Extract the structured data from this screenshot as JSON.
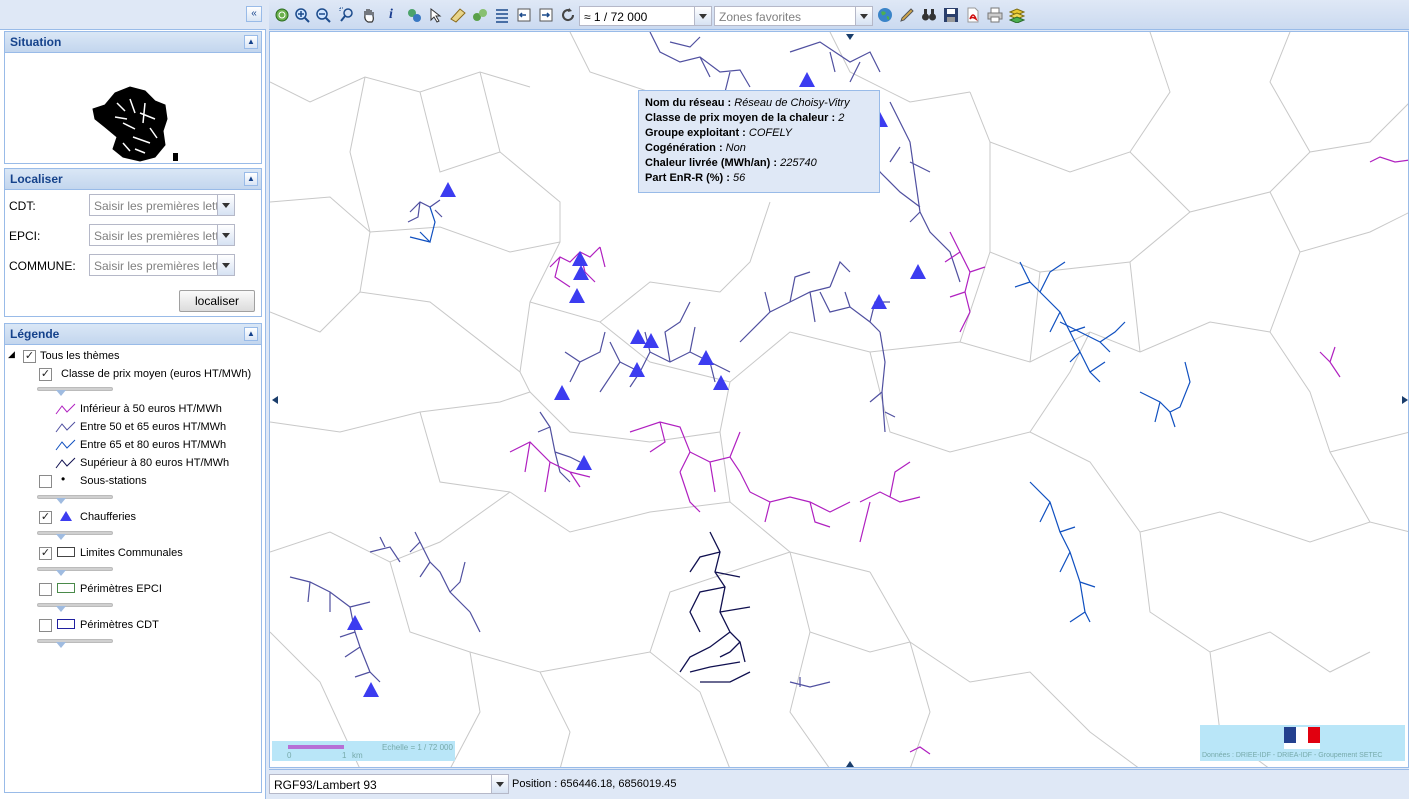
{
  "left_panel": {
    "collapse_icon": "double-chevron-left",
    "situation": {
      "title": "Situation"
    },
    "localiser": {
      "title": "Localiser",
      "fields": [
        {
          "label": "CDT:",
          "placeholder": "Saisir les premières lettres"
        },
        {
          "label": "EPCI:",
          "placeholder": "Saisir les premières lettres"
        },
        {
          "label": "COMMUNE:",
          "placeholder": "Saisir les premières lettres"
        }
      ],
      "button": "localiser"
    },
    "legende": {
      "title": "Légende",
      "root": "Tous les thèmes",
      "layers": [
        {
          "label": "Classe de prix moyen (euros HT/MWh)",
          "checked": true
        },
        {
          "label": "Sous-stations",
          "checked": false
        },
        {
          "label": "Chaufferies",
          "checked": true
        },
        {
          "label": "Limites Communales",
          "checked": true
        },
        {
          "label": "Périmètres EPCI",
          "checked": false
        },
        {
          "label": "Périmètres CDT",
          "checked": false
        }
      ],
      "price_classes": [
        {
          "label": "Inférieur à 50 euros HT/MWh",
          "color": "#b020c0"
        },
        {
          "label": "Entre 50 et 65 euros HT/MWh",
          "color": "#5050a0"
        },
        {
          "label": "Entre 65 et 80 euros HT/MWh",
          "color": "#1050c0"
        },
        {
          "label": "Supérieur à 80 euros HT/MWh",
          "color": "#101050"
        }
      ]
    }
  },
  "toolbar": {
    "icons": [
      "zoom-extent",
      "zoom-in",
      "zoom-out",
      "zoom-box",
      "pan-hand",
      "info",
      "query",
      "select",
      "measure-area",
      "measure-line",
      "list",
      "previous-view",
      "next-view",
      "refresh",
      "globe",
      "pencil",
      "binoculars",
      "save",
      "pdf",
      "print",
      "layers"
    ],
    "scale_value": "≈ 1 / 72 000",
    "favorites_placeholder": "Zones favorites"
  },
  "popup": {
    "rows": [
      {
        "key": "Nom du réseau :",
        "value": "Réseau de Choisy-Vitry"
      },
      {
        "key": "Classe de prix moyen de la chaleur :",
        "value": "2"
      },
      {
        "key": "Groupe exploitant :",
        "value": "COFELY"
      },
      {
        "key": "Cogénération :",
        "value": "Non"
      },
      {
        "key": "Chaleur livrée (MWh/an) :",
        "value": "225740"
      },
      {
        "key": "Part EnR-R (%) :",
        "value": "56"
      }
    ]
  },
  "map": {
    "scale_label": "Echelle = 1 / 72 000",
    "scale_ticks": [
      "0",
      "1",
      "km"
    ],
    "credit": "Données : DRIEE-IDF - DRIEA-IDF - Groupement SETEC",
    "colors": {
      "magenta": "#b020c0",
      "slate": "#5050a0",
      "blue": "#1050c0",
      "navy": "#101050",
      "triangle": "#3c3cf0"
    }
  },
  "status": {
    "projection": "RGF93/Lambert 93",
    "position": "Position : 656446.18, 6856019.45"
  }
}
